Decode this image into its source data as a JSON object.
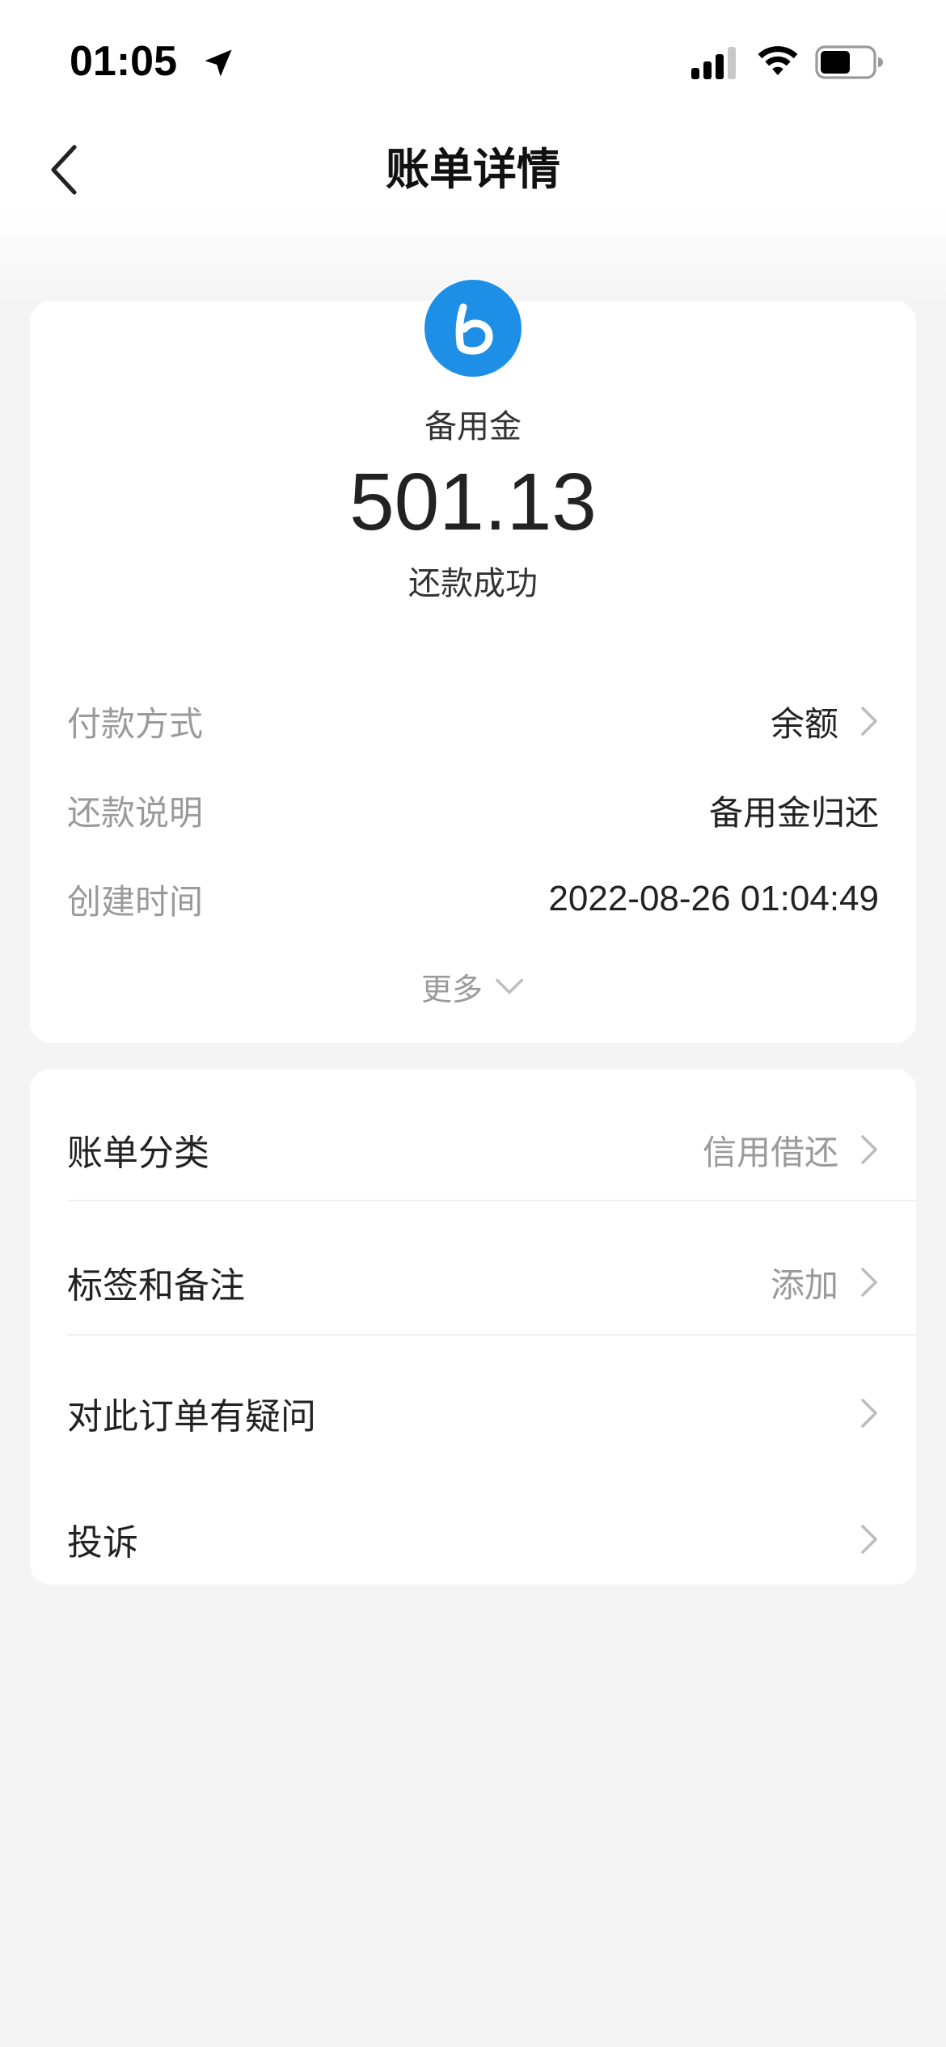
{
  "status_bar": {
    "time": "01:05"
  },
  "nav": {
    "title": "账单详情"
  },
  "summary": {
    "merchant": "备用金",
    "amount": "501.13",
    "status": "还款成功",
    "rows": [
      {
        "label": "付款方式",
        "value": "余额"
      },
      {
        "label": "还款说明",
        "value": "备用金归还"
      },
      {
        "label": "创建时间",
        "value": "2022-08-26 01:04:49"
      }
    ],
    "more_label": "更多"
  },
  "options": [
    {
      "label": "账单分类",
      "value": "信用借还"
    },
    {
      "label": "标签和备注",
      "value": "添加"
    },
    {
      "label": "对此订单有疑问",
      "value": ""
    },
    {
      "label": "投诉",
      "value": ""
    }
  ],
  "colors": {
    "brand_blue": "#1e8fe6",
    "muted_text": "#9a9a9a",
    "background": "#f4f4f4"
  }
}
